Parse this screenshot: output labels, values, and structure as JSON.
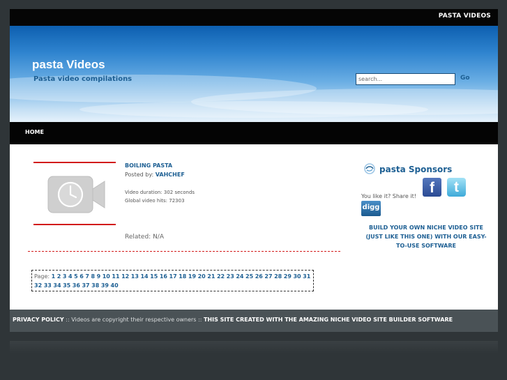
{
  "topbar": {
    "link": "PASTA VIDEOS"
  },
  "header": {
    "title": "pasta Videos",
    "tagline": "Pasta video compilations",
    "search_placeholder": "search...",
    "go_label": "Go"
  },
  "nav": {
    "home": "HOME"
  },
  "video": {
    "title": "BOILING PASTA",
    "posted_by_label": "Posted by: ",
    "author": "VAHCHEF",
    "duration": "Video duration: 302 seconds",
    "hits": "Global video hits: 72303",
    "related": "Related: N/A",
    "thumb_icon": "video-camera-clock-icon"
  },
  "pager": {
    "label": "Page: ",
    "pages": [
      "1",
      "2",
      "3",
      "4",
      "5",
      "6",
      "7",
      "8",
      "9",
      "10",
      "11",
      "12",
      "13",
      "14",
      "15",
      "16",
      "17",
      "18",
      "19",
      "20",
      "21",
      "22",
      "23",
      "24",
      "25",
      "26",
      "27",
      "28",
      "29",
      "30",
      "31",
      "32",
      "33",
      "34",
      "35",
      "36",
      "37",
      "38",
      "39",
      "40"
    ]
  },
  "sidebar": {
    "sponsor_title": "pasta Sponsors",
    "share_text": "You like it? Share it!",
    "facebook_glyph": "f",
    "twitter_glyph": "t",
    "digg_label": "digg",
    "build_link": "BUILD YOUR OWN NICHE VIDEO SITE (JUST LIKE THIS ONE) WITH OUR EASY-TO-USE SOFTWARE"
  },
  "footer": {
    "privacy": "PRIVACY POLICY",
    "sep1": " :: ",
    "copyright": "Videos are copyright their respective owners",
    "sep2": " :: ",
    "builder_link": "THIS SITE CREATED WITH THE AMAZING NICHE VIDEO SITE BUILDER SOFTWARE"
  },
  "colors": {
    "link": "#1d5f93",
    "accent_red": "#d21a1a",
    "background": "#2f3538"
  }
}
